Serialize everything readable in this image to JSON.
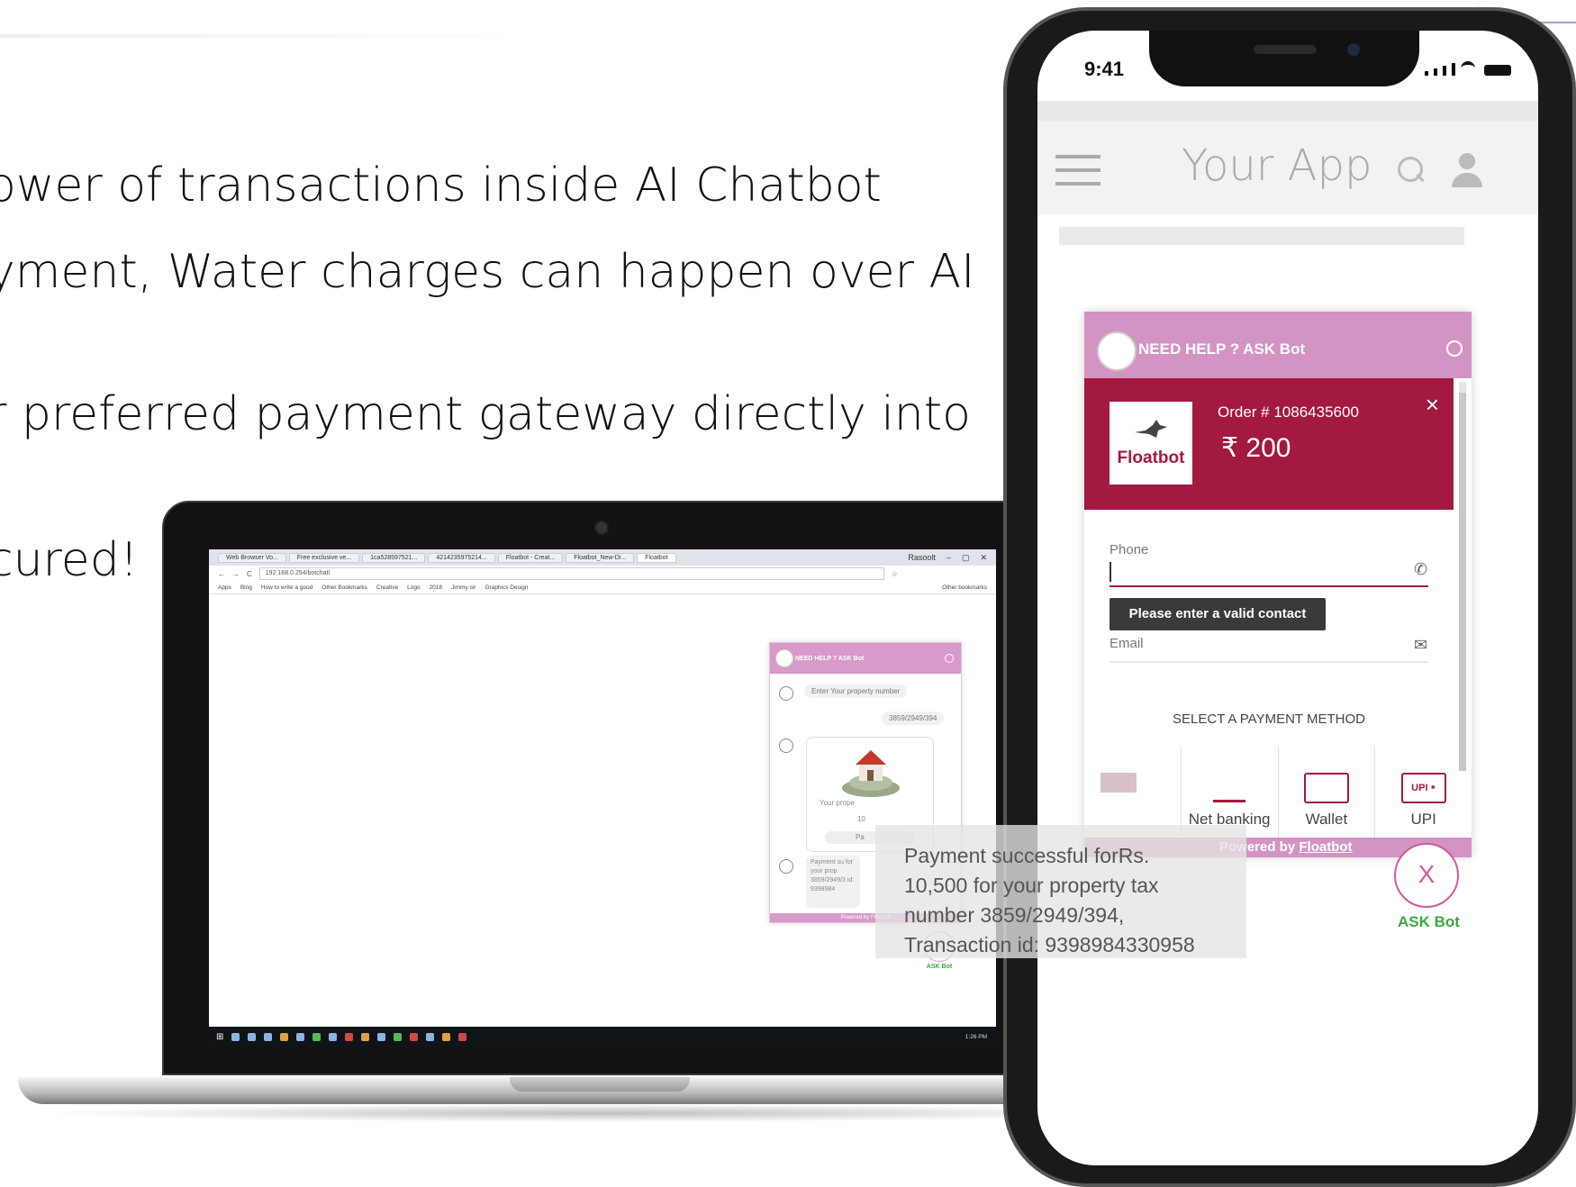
{
  "slide": {
    "lines": [
      "ower of transactions inside AI Chatbot",
      "yment, Water charges can happen over AI",
      "r preferred payment gateway directly into",
      "cured!"
    ]
  },
  "laptop": {
    "browser": {
      "tabs": [
        "Web Browser Vo...",
        "Free exclusive ve...",
        "1ca528597521...",
        "4214235975214...",
        "Floatbot - Creat...",
        "Floatbot_New-Di...",
        "Floatbot"
      ],
      "window_label": "Rasoolt",
      "url": "192.168.0.254/botchat/",
      "bookmarks": [
        "Apps",
        "Bing",
        "How to write a good",
        "Other Bookmarks",
        "Creative",
        "Logo",
        "2018",
        "Jimmy sir",
        "Graphics Design"
      ],
      "other_bookmarks": "Other bookmarks"
    },
    "chat": {
      "header": "NEED HELP ? ASK Bot",
      "bubble_prompt": "Enter Your property number",
      "bubble_user": "3859/2949/394",
      "card_caption": "Your prope",
      "card_caption2": "10",
      "card_button": "Pa",
      "payment_preview": "Payment su for your prop 3859/2949/3 id: 9398984",
      "footer": "Powered by Floatbot",
      "ask_icon": "X",
      "ask_label": "ASK Bot"
    },
    "taskbar": {
      "clock": "1:26 PM"
    }
  },
  "phone": {
    "status": {
      "time": "9:41"
    },
    "app_title": "Your App",
    "bot": {
      "header": "NEED HELP ? ASK Bot",
      "merchant_logo_text": "Floatbot",
      "order_number": "Order # 1086435600",
      "amount": "₹ 200",
      "close_icon": "×",
      "phone_label": "Phone",
      "phone_icon": "✆",
      "tooltip": "Please enter a valid contact number",
      "email_label": "Email",
      "email_icon": "✉",
      "payment_title": "SELECT A PAYMENT METHOD",
      "methods": [
        "Net banking",
        "Wallet",
        "UPI"
      ],
      "upi_icon_text": "UPI ⁍",
      "footer_prefix": "Powered by ",
      "footer_link": "Floatbot"
    },
    "ask": {
      "icon": "X",
      "label": "ASK Bot"
    }
  },
  "toast": {
    "text": "Payment successful forRs. 10,500 for your property tax number 3859/2949/394, Transaction id: 9398984330958"
  }
}
